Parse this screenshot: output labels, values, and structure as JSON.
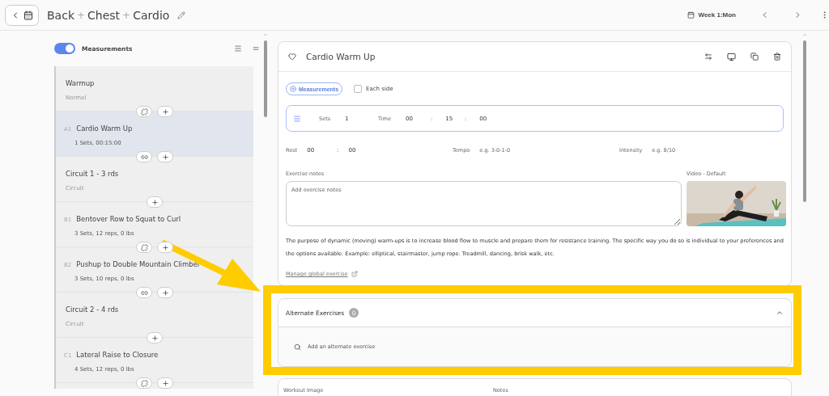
{
  "header": {
    "title_parts": [
      "Back",
      "+",
      "Chest",
      "+",
      "Cardio"
    ],
    "week": "Week 1:Mon"
  },
  "sidebar": {
    "measurements_toggle": {
      "label": "Measurements",
      "on": true
    },
    "items": [
      {
        "kind": "section",
        "title": "Warmup",
        "subtitle": "Normal",
        "selected": false,
        "linked": false
      },
      {
        "kind": "exercise",
        "code": "A1",
        "title": "Cardio Warm Up",
        "subtitle": "1 Sets, 00:15:00",
        "selected": true,
        "linked": true
      },
      {
        "kind": "section",
        "title": "Circuit 1 - 3 rds",
        "subtitle": "Circuit",
        "selected": false
      },
      {
        "kind": "exercise",
        "code": "B1",
        "title": "Bentover Row to Squat to Curl",
        "subtitle": "3 Sets, 12 reps, 0 lbs",
        "selected": false,
        "linked": false
      },
      {
        "kind": "exercise",
        "code": "B2",
        "title": "Pushup to Double Mountain Climber",
        "subtitle": "3 Sets, 10 reps, 0 lbs",
        "selected": false,
        "linked": true
      },
      {
        "kind": "section",
        "title": "Circuit 2 - 4 rds",
        "subtitle": "Circuit",
        "selected": false
      },
      {
        "kind": "exercise",
        "code": "C1",
        "title": "Lateral Raise to Closure",
        "subtitle": "4 Sets, 12 reps, 0 lbs",
        "selected": false,
        "linked": false
      }
    ]
  },
  "exercise": {
    "title": "Cardio Warm Up",
    "measurements_button": "Measurements",
    "each_side": {
      "label": "Each side",
      "checked": false
    },
    "sets_row": [
      {
        "label": "Sets",
        "value": "1"
      },
      {
        "label": "Time",
        "value": "00"
      },
      {
        "label": ":",
        "value": "15"
      },
      {
        "label": ":",
        "value": "00"
      }
    ],
    "rest": {
      "label": "Rest",
      "values": [
        "00",
        ":",
        "00"
      ]
    },
    "tempo": {
      "label": "Tempo",
      "placeholder": "e.g. 3-0-1-0"
    },
    "intensity": {
      "label": "Intensity",
      "placeholder": "e.g. 8/10"
    },
    "notes": {
      "label": "Exercise notes",
      "placeholder": "Add exercise notes"
    },
    "video": {
      "label": "Video - Default",
      "kind": "picture"
    },
    "description": "The purpose of dynamic (moving) warm-ups is to increase blood flow to muscle and prepare them for resistance training. The specific way you do so is individual to your preferences and the options available. Example: elliptical, stairmaster, jump rope. Treadmill, dancing, brisk walk, etc.",
    "manage_link": "Manage global exercise"
  },
  "alternates": {
    "title": "Alternate Exercises",
    "count": "0",
    "expanded": true,
    "search_placeholder": "Add an alternate exercise"
  },
  "workout": {
    "image_label": "Workout Image",
    "notes_label": "Notes"
  }
}
